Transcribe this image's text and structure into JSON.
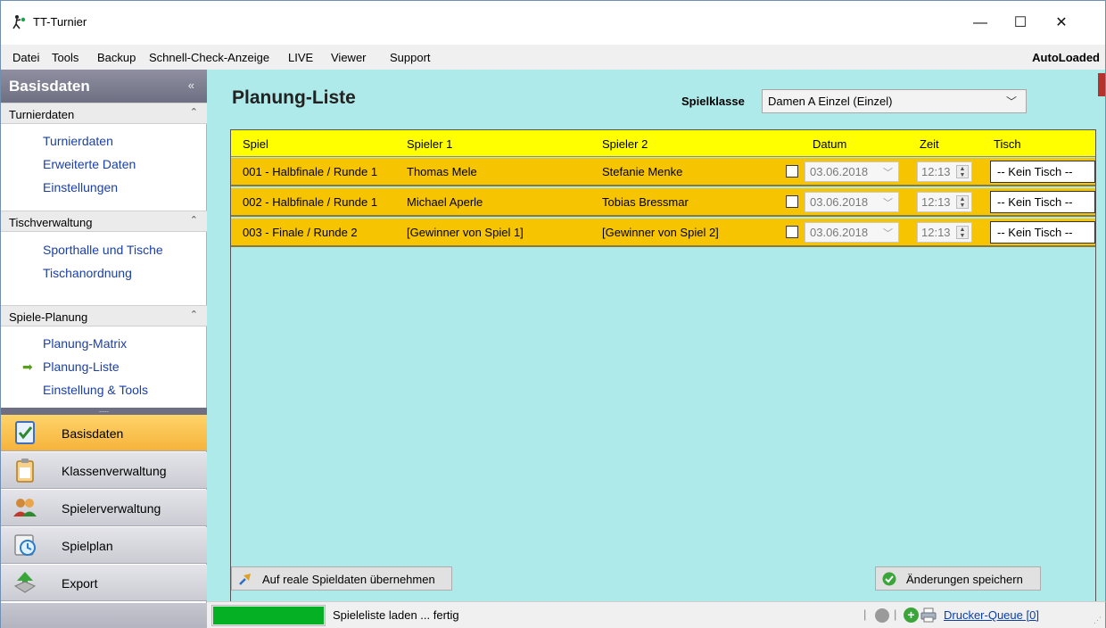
{
  "window": {
    "title": "TT-Turnier",
    "app_icon": "table-tennis-player-icon",
    "controls": {
      "minimize": "—",
      "maximize": "☐",
      "close": "✕"
    }
  },
  "menu": {
    "items": [
      "Datei",
      "Tools",
      "Backup",
      "Schnell-Check-Anzeige",
      "LIVE",
      "Viewer",
      "Support"
    ],
    "right_label": "AutoLoaded"
  },
  "sidebar": {
    "header": {
      "title": "Basisdaten",
      "chevron": "«"
    },
    "groups": [
      {
        "label": "Turnierdaten",
        "chevron": "⌃",
        "links": [
          "Turnierdaten",
          "Erweiterte Daten",
          "Einstellungen"
        ]
      },
      {
        "label": "Tischverwaltung",
        "chevron": "⌃",
        "links": [
          "Sporthalle und Tische",
          "Tischanordnung"
        ]
      },
      {
        "label": "Spiele-Planung",
        "chevron": "⌃",
        "links": [
          "Planung-Matrix",
          "Planung-Liste",
          "Einstellung & Tools"
        ],
        "active_index": 1
      }
    ],
    "grip": ".....",
    "modules": [
      {
        "label": "Basisdaten",
        "icon": "checklist-icon",
        "active": true
      },
      {
        "label": "Klassenverwaltung",
        "icon": "clipboard-icon",
        "active": false
      },
      {
        "label": "Spielerverwaltung",
        "icon": "users-icon",
        "active": false
      },
      {
        "label": "Spielplan",
        "icon": "clock-icon",
        "active": false
      },
      {
        "label": "Export",
        "icon": "export-arrow-icon",
        "active": false
      }
    ]
  },
  "main": {
    "title": "Planung-Liste",
    "spielklasse": {
      "label": "Spielklasse",
      "value": "Damen A Einzel (Einzel)"
    },
    "columns": [
      "Spiel",
      "Spieler 1",
      "Spieler 2",
      "Datum",
      "Zeit",
      "Tisch"
    ],
    "rows": [
      {
        "spiel": "001 - Halbfinale / Runde 1",
        "spieler1": "Thomas Mele",
        "spieler2": "Stefanie Menke",
        "datum": "03.06.2018",
        "zeit": "12:13",
        "tisch": "-- Kein Tisch --"
      },
      {
        "spiel": "002 - Halbfinale / Runde 1",
        "spieler1": "Michael Aperle",
        "spieler2": "Tobias Bressmar",
        "datum": "03.06.2018",
        "zeit": "12:13",
        "tisch": "-- Kein Tisch --"
      },
      {
        "spiel": "003 - Finale / Runde 2",
        "spieler1": "[Gewinner von Spiel 1]",
        "spieler2": "[Gewinner von Spiel 2]",
        "datum": "03.06.2018",
        "zeit": "12:13",
        "tisch": "-- Kein Tisch --"
      }
    ],
    "buttons": {
      "apply": "Auf reale Spieldaten übernehmen",
      "save": "Änderungen speichern"
    }
  },
  "status": {
    "progress_percent": 100,
    "text": "Spieleliste laden ... fertig",
    "queue_link": "Drucker-Queue [0]",
    "separator": "|"
  },
  "colors": {
    "main_bg": "#aeeaea",
    "grid_header": "#ffff00",
    "grid_row": "#f6c400",
    "active_module": "#f6b33b",
    "link": "#1a3fa6"
  }
}
